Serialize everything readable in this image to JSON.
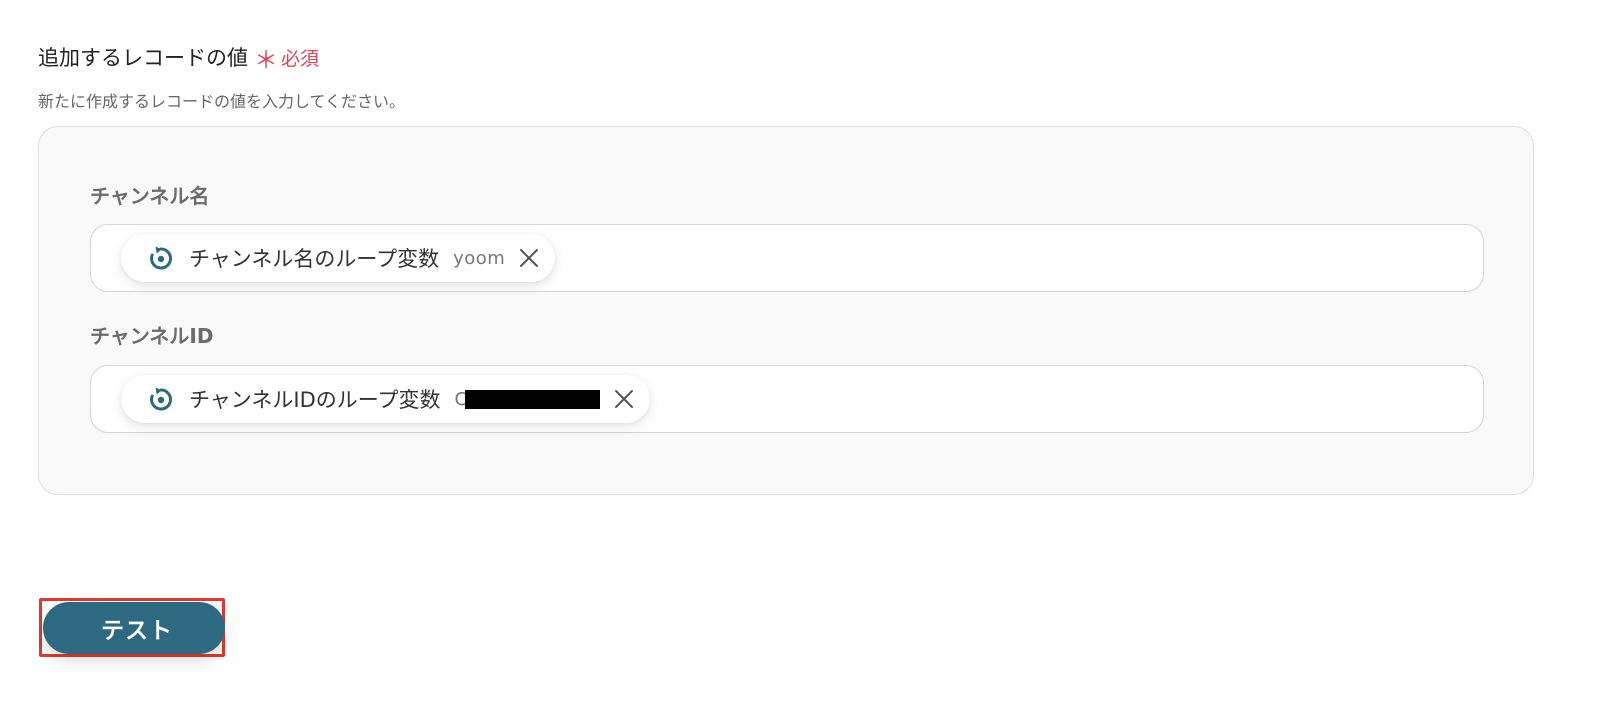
{
  "section": {
    "title": "追加するレコードの値",
    "required_mark": "＊",
    "required_label": "必須",
    "description": "新たに作成するレコードの値を入力してください。"
  },
  "fields": [
    {
      "label": "チャンネル名",
      "chip": {
        "icon": "loop-icon",
        "label": "チャンネル名のループ変数",
        "value": "yoom"
      }
    },
    {
      "label": "チャンネルID",
      "chip": {
        "icon": "loop-icon",
        "label": "チャンネルIDのループ変数",
        "value": "C",
        "value_redacted": true
      }
    }
  ],
  "actions": {
    "test_label": "テスト"
  },
  "colors": {
    "accent": "#2d6a82",
    "required": "#e0455a",
    "highlight_border": "#e03a2e",
    "panel_bg": "#f9f9f9"
  }
}
